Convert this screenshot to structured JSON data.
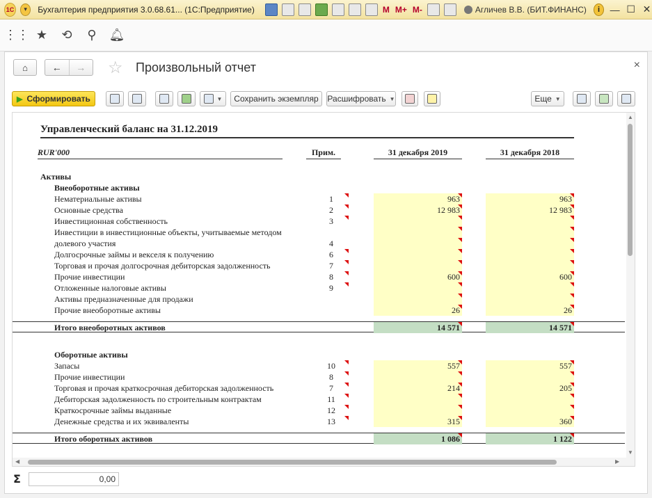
{
  "window": {
    "title": "Бухгалтерия предприятия 3.0.68.61...  (1С:Предприятие)",
    "logo": "1С",
    "m_labels": [
      "M",
      "M+",
      "M-"
    ],
    "user": "Агличев В.В. (БИТ.ФИНАНС)"
  },
  "page": {
    "title": "Произвольный отчет"
  },
  "toolbar": {
    "generate": "Сформировать",
    "save_copy": "Сохранить экземпляр",
    "decode": "Расшифровать",
    "more": "Еще"
  },
  "report": {
    "title": "Управленческий баланс на 31.12.2019",
    "currency": "RUR'000",
    "col_note": "Прим.",
    "col_2019": "31 декабря 2019",
    "col_2018": "31 декабря 2018",
    "section_assets": "Активы",
    "group_noncurrent": "Внеоборотные активы",
    "noncurrent_rows": [
      {
        "label": "Нематериальные активы",
        "note": "1",
        "v2019": "963",
        "v2018": "963"
      },
      {
        "label": "Основные средства",
        "note": "2",
        "v2019": "12 983",
        "v2018": "12 983"
      },
      {
        "label": "Инвестиционная собственность",
        "note": "3",
        "v2019": "",
        "v2018": ""
      },
      {
        "label": "Инвестиции в инвестиционные объекты, учитываемые методом",
        "note": "",
        "v2019": "",
        "v2018": ""
      },
      {
        "label": "долевого участия",
        "note": "4",
        "v2019": "",
        "v2018": ""
      },
      {
        "label": "Долгосрочные займы и векселя к получению",
        "note": "6",
        "v2019": "",
        "v2018": ""
      },
      {
        "label": "Торговая и прочая долгосрочная дебиторская задолженность",
        "note": "7",
        "v2019": "",
        "v2018": ""
      },
      {
        "label": "Прочие инвестиции",
        "note": "8",
        "v2019": "600",
        "v2018": "600"
      },
      {
        "label": "Отложенные налоговые активы",
        "note": "9",
        "v2019": "",
        "v2018": ""
      },
      {
        "label": "Активы предназначенные для продажи",
        "note": "",
        "v2019": "",
        "v2018": ""
      },
      {
        "label": "Прочие внеоборотные активы",
        "note": "",
        "v2019": "26",
        "v2018": "26"
      }
    ],
    "total_noncurrent": {
      "label": "Итого внеоборотных активов",
      "v2019": "14 571",
      "v2018": "14 571"
    },
    "group_current": "Оборотные активы",
    "current_rows": [
      {
        "label": "Запасы",
        "note": "10",
        "v2019": "557",
        "v2018": "557"
      },
      {
        "label": "Прочие инвестиции",
        "note": "8",
        "v2019": "",
        "v2018": ""
      },
      {
        "label": "Торговая и прочая краткосрочная дебиторская задолженность",
        "note": "7",
        "v2019": "214",
        "v2018": "205"
      },
      {
        "label": "Дебиторская задолженность по строительным контрактам",
        "note": "11",
        "v2019": "",
        "v2018": ""
      },
      {
        "label": "Краткосрочные займы выданные",
        "note": "12",
        "v2019": "",
        "v2018": ""
      },
      {
        "label": "Денежные средства и их эквиваленты",
        "note": "13",
        "v2019": "315",
        "v2018": "360"
      }
    ],
    "total_current": {
      "label": "Итого оборотных активов",
      "v2019": "1 086",
      "v2018": "1 122"
    }
  },
  "sum": {
    "symbol": "Σ",
    "value": "0,00"
  }
}
